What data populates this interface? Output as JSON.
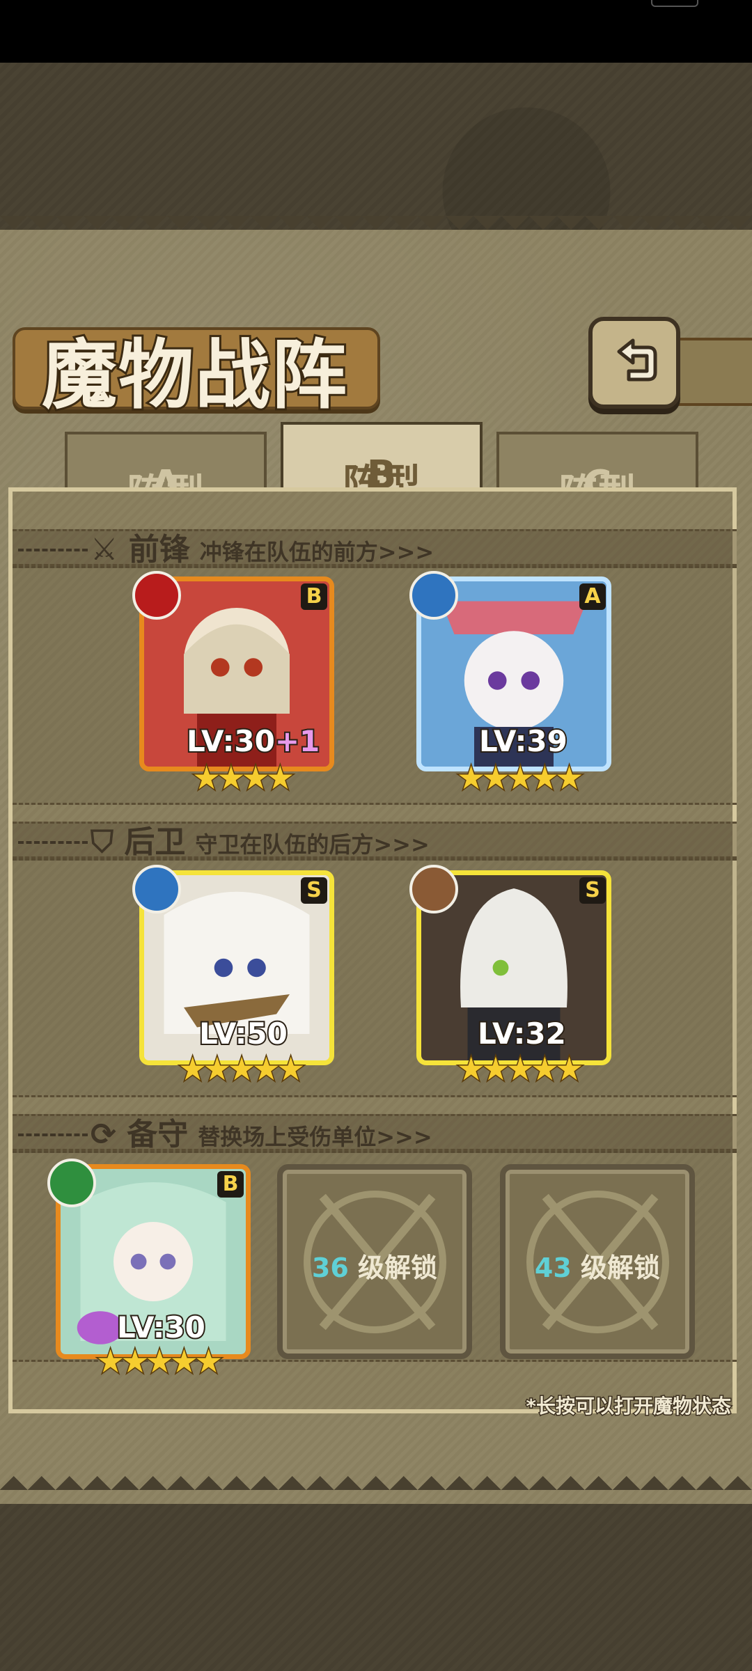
{
  "screen": {
    "title": "魔物战阵",
    "back_icon": "return-arrow-icon"
  },
  "tabs": [
    {
      "prefix": "阵型",
      "letter": "A",
      "active": false
    },
    {
      "prefix": "阵型",
      "letter": "B",
      "active": true
    },
    {
      "prefix": "阵型",
      "letter": "C",
      "active": false
    }
  ],
  "sections": {
    "front": {
      "title": "前锋",
      "subtitle": "冲锋在队伍的前方>>>",
      "icon": "sword-icon"
    },
    "back": {
      "title": "后卫",
      "subtitle": "守卫在队伍的后方>>>",
      "icon": "shield-icon"
    },
    "reserve": {
      "title": "备守",
      "subtitle": "替换场上受伤单位>>>",
      "icon": "swap-icon"
    }
  },
  "front_units": [
    {
      "element": "fire",
      "rank": "B",
      "level": "LV:30",
      "bonus": "+1",
      "stars": "★★★★",
      "star_count": 4
    },
    {
      "element": "water",
      "rank": "A",
      "level": "LV:39",
      "stars": "★★★★★",
      "star_count": 5
    }
  ],
  "back_units": [
    {
      "element": "water",
      "rank": "S",
      "level": "LV:50",
      "stars": "★★★★★",
      "star_count": 5
    },
    {
      "element": "earth",
      "rank": "S",
      "level": "LV:32",
      "stars": "★★★★★",
      "star_count": 5
    }
  ],
  "reserve_units": [
    {
      "element": "leaf",
      "rank": "B",
      "level": "LV:30",
      "stars": "★★★★★",
      "star_count": 5
    }
  ],
  "locked_slots": [
    {
      "level": "36",
      "label": "级解锁"
    },
    {
      "level": "43",
      "label": "级解锁"
    }
  ],
  "footnote": "*长按可以打开魔物状态",
  "colors": {
    "tab_letter_active": "#f0b12a",
    "unlock_level": "#5fd0d6"
  }
}
